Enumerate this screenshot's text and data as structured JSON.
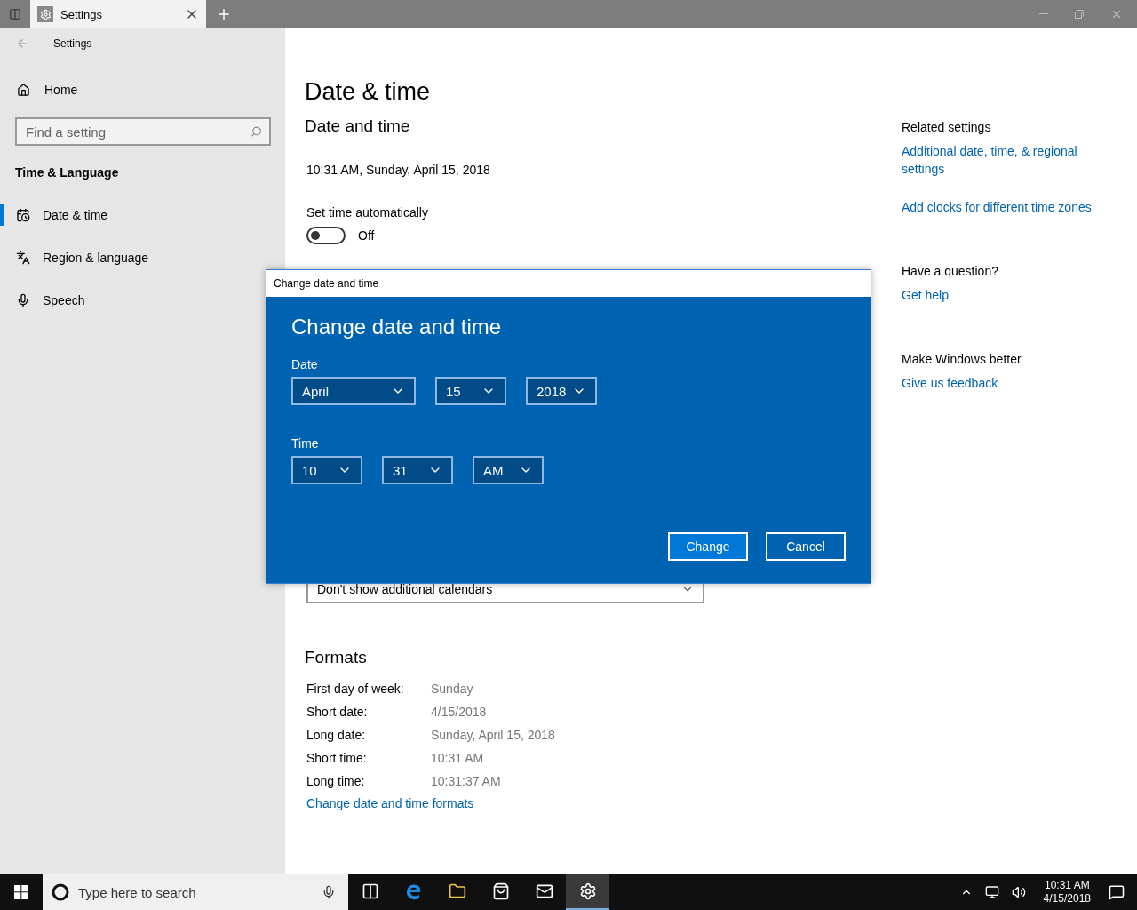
{
  "window": {
    "tab_title": "Settings",
    "header_title": "Settings"
  },
  "sidebar": {
    "home": "Home",
    "search_placeholder": "Find a setting",
    "section": "Time & Language",
    "items": [
      {
        "label": "Date & time",
        "selected": true,
        "kind": "calendar"
      },
      {
        "label": "Region & language",
        "selected": false,
        "kind": "language"
      },
      {
        "label": "Speech",
        "selected": false,
        "kind": "microphone"
      }
    ]
  },
  "page": {
    "title": "Date & time",
    "section": "Date and time",
    "current": "10:31 AM, Sunday, April 15, 2018",
    "auto_time": {
      "label": "Set time automatically",
      "on": false,
      "state_text": "Off"
    },
    "calendar_dropdown": "Don't show additional calendars",
    "formats_title": "Formats",
    "formats": [
      {
        "label": "First day of week:",
        "value": "Sunday"
      },
      {
        "label": "Short date:",
        "value": "4/15/2018"
      },
      {
        "label": "Long date:",
        "value": "Sunday, April 15, 2018"
      },
      {
        "label": "Short time:",
        "value": "10:31 AM"
      },
      {
        "label": "Long time:",
        "value": "10:31:37 AM"
      }
    ],
    "formats_link": "Change date and time formats"
  },
  "related": [
    {
      "title": "Related settings",
      "links": [
        "Additional date, time, & regional settings",
        "Add clocks for different time zones"
      ]
    },
    {
      "title": "Have a question?",
      "links": [
        "Get help"
      ]
    },
    {
      "title": "Make Windows better",
      "links": [
        "Give us feedback"
      ]
    }
  ],
  "dialog": {
    "window_title": "Change date and time",
    "heading": "Change date and time",
    "groups": [
      {
        "label": "Date",
        "fields": [
          {
            "value": "April",
            "wide": true
          },
          {
            "value": "15",
            "wide": false
          },
          {
            "value": "2018",
            "wide": false
          }
        ]
      },
      {
        "label": "Time",
        "fields": [
          {
            "value": "10",
            "wide": false
          },
          {
            "value": "31",
            "wide": false
          },
          {
            "value": "AM",
            "wide": false
          }
        ]
      }
    ],
    "buttons": [
      "Change",
      "Cancel"
    ]
  },
  "taskbar": {
    "search_placeholder": "Type here to search",
    "apps": [
      {
        "kind": "taskview",
        "selected": false
      },
      {
        "kind": "browser",
        "selected": false
      },
      {
        "kind": "folder",
        "selected": false
      },
      {
        "kind": "store",
        "selected": false
      },
      {
        "kind": "mail",
        "selected": false
      },
      {
        "kind": "settings",
        "selected": true
      }
    ],
    "time": "10:31 AM",
    "date": "4/15/2018"
  }
}
